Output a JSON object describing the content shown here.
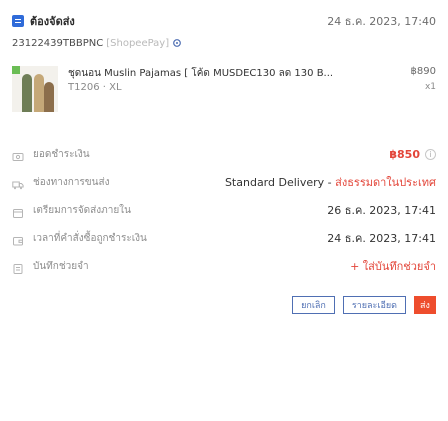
{
  "header": {
    "title": "ต้องจัดส่ง",
    "date": "24 ธ.ค. 2023, 17:40"
  },
  "order": {
    "id": "23122439TBBPNC",
    "shop": "[ShopeePay]"
  },
  "product": {
    "name": "ชุดนอน Muslin Pajamas [ โค้ด MUSDEC130 ลด 130 B...",
    "price": "฿890",
    "variant": "T1206 · XL",
    "quantity": "x1"
  },
  "details": [
    {
      "label": "ยอดชำระเงิน",
      "value": "฿850",
      "icon": "cash-icon"
    },
    {
      "label": "ช่องทางการขนส่ง",
      "value_main": "Standard Delivery - ",
      "value_accent": "ส่งธรรมดาในประเทศ",
      "icon": "truck-icon"
    },
    {
      "label": "เตรียมการจัดส่งภายใน",
      "value": "26 ธ.ค. 2023, 17:41",
      "icon": "calendar-icon"
    },
    {
      "label": "เวลาที่คำสั่งซื้อถูกชำระเงิน",
      "value": "24 ธ.ค. 2023, 17:41",
      "icon": "wallet-icon"
    },
    {
      "label": "บันทึกช่วยจำ",
      "value": "+ ใส่บันทึกช่วยจำ",
      "icon": "note-icon"
    }
  ],
  "actions": {
    "cancel": "ยกเลิก",
    "details": "รายละเอียด",
    "ship": "ส่ง"
  },
  "colors": {
    "accent": "#ee4d2d",
    "link": "#4f6fb3",
    "price": "#e3463a"
  }
}
